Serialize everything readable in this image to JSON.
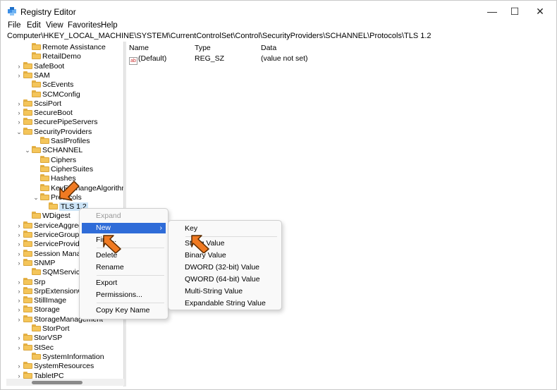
{
  "window": {
    "title": "Registry Editor",
    "minimize_glyph": "—",
    "maximize_glyph": "☐",
    "close_glyph": "✕"
  },
  "menubar": {
    "items": [
      "File",
      "Edit",
      "View",
      "Favorites",
      "Help"
    ]
  },
  "address": {
    "path": "Computer\\HKEY_LOCAL_MACHINE\\SYSTEM\\CurrentControlSet\\Control\\SecurityProviders\\SCHANNEL\\Protocols\\TLS 1.2"
  },
  "tree": {
    "items": [
      {
        "label": "Remote Assistance",
        "chevron": ""
      },
      {
        "label": "RetailDemo",
        "chevron": ""
      },
      {
        "label": "SafeBoot",
        "chevron": ">"
      },
      {
        "label": "SAM",
        "chevron": ">"
      },
      {
        "label": "ScEvents",
        "chevron": ""
      },
      {
        "label": "SCMConfig",
        "chevron": ""
      },
      {
        "label": "ScsiPort",
        "chevron": ">"
      },
      {
        "label": "SecureBoot",
        "chevron": ">"
      },
      {
        "label": "SecurePipeServers",
        "chevron": ">"
      },
      {
        "label": "SecurityProviders",
        "chevron": "v"
      },
      {
        "label": "SaslProfiles",
        "chevron": ""
      },
      {
        "label": "SCHANNEL",
        "chevron": "v"
      },
      {
        "label": "Ciphers",
        "chevron": ""
      },
      {
        "label": "CipherSuites",
        "chevron": ""
      },
      {
        "label": "Hashes",
        "chevron": ""
      },
      {
        "label": "KeyExchangeAlgorithms",
        "chevron": ""
      },
      {
        "label": "Protocols",
        "chevron": "v"
      },
      {
        "label": "TLS 1.2",
        "chevron": ""
      },
      {
        "label": "WDigest",
        "chevron": ""
      },
      {
        "label": "ServiceAggregatedEvents",
        "chevron": ">"
      },
      {
        "label": "ServiceGroupOrder",
        "chevron": ">"
      },
      {
        "label": "ServiceProvider",
        "chevron": ">"
      },
      {
        "label": "Session Manager",
        "chevron": ">"
      },
      {
        "label": "SNMP",
        "chevron": ">"
      },
      {
        "label": "SQMServiceList",
        "chevron": ""
      },
      {
        "label": "Srp",
        "chevron": ">"
      },
      {
        "label": "SrpExtensionConfig",
        "chevron": ">"
      },
      {
        "label": "StillImage",
        "chevron": ">"
      },
      {
        "label": "Storage",
        "chevron": ">"
      },
      {
        "label": "StorageManagement",
        "chevron": ">"
      },
      {
        "label": "StorPort",
        "chevron": ""
      },
      {
        "label": "StorVSP",
        "chevron": ">"
      },
      {
        "label": "StSec",
        "chevron": ">"
      },
      {
        "label": "SystemInformation",
        "chevron": ""
      },
      {
        "label": "SystemResources",
        "chevron": ">"
      },
      {
        "label": "TabletPC",
        "chevron": ">"
      }
    ]
  },
  "list": {
    "headers": {
      "name": "Name",
      "type": "Type",
      "data": "Data"
    },
    "rows": [
      {
        "icon": "ab",
        "name": "(Default)",
        "type": "REG_SZ",
        "data": "(value not set)"
      }
    ]
  },
  "context_menu": {
    "items": [
      "Expand",
      "New",
      "Find...",
      "Delete",
      "Rename",
      "Export",
      "Permissions...",
      "Copy Key Name"
    ],
    "submenu_arrow": "›"
  },
  "submenu": {
    "items": [
      "Key",
      "String Value",
      "Binary Value",
      "DWORD (32-bit) Value",
      "QWORD (64-bit) Value",
      "Multi-String Value",
      "Expandable String Value"
    ]
  },
  "colors": {
    "menu_highlight": "#2f6cd8",
    "selection": "#cce4f7",
    "arrow": "#f07a22",
    "folder": "#f4c55a"
  }
}
